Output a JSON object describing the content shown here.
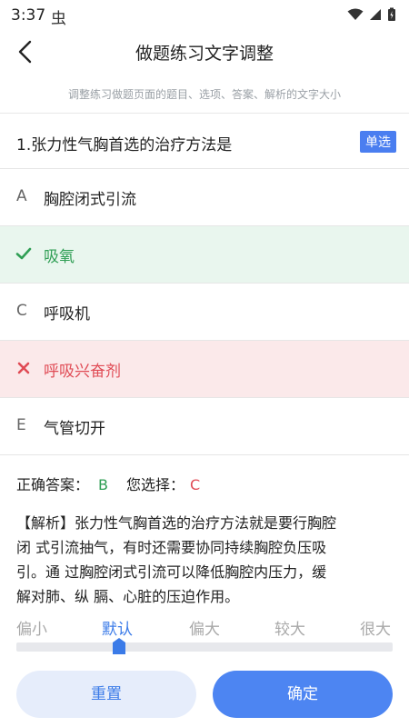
{
  "status": {
    "time": "3:37",
    "app_glyph": "虫"
  },
  "nav": {
    "title": "做题练习文字调整"
  },
  "hint": "调整练习做题页面的题目、选项、答案、解析的文字大小",
  "question": {
    "text": "1.张力性气胸首选的治疗方法是",
    "badge": "单选"
  },
  "options": [
    {
      "letter": "A",
      "label": "胸腔闭式引流",
      "state": "normal"
    },
    {
      "letter": "",
      "label": "吸氧",
      "state": "correct"
    },
    {
      "letter": "C",
      "label": "呼吸机",
      "state": "normal"
    },
    {
      "letter": "",
      "label": "呼吸兴奋剂",
      "state": "wrong"
    },
    {
      "letter": "E",
      "label": "气管切开",
      "state": "normal"
    }
  ],
  "answer": {
    "correct_label": "正确答案：",
    "correct_value": "B",
    "choice_label": "您选择：",
    "choice_value": "C"
  },
  "analysis": {
    "line1": "【解析】张力性气胸首选的治疗方法就是要行胸腔",
    "line2": "闭 式引流抽气，有时还需要协同持续胸腔负压吸",
    "line3": "引。通 过胸腔闭式引流可以降低胸腔内压力，缓",
    "line4": "解对肺、纵 膈、心脏的压迫作用。"
  },
  "font_sizes": {
    "options": [
      "偏小",
      "默认",
      "偏大",
      "较大",
      "很大"
    ],
    "selected": "默认"
  },
  "buttons": {
    "reset": "重置",
    "confirm": "确定"
  },
  "colors": {
    "accent": "#4d85f2",
    "correct": "#2f9e54",
    "wrong": "#e04b55"
  }
}
